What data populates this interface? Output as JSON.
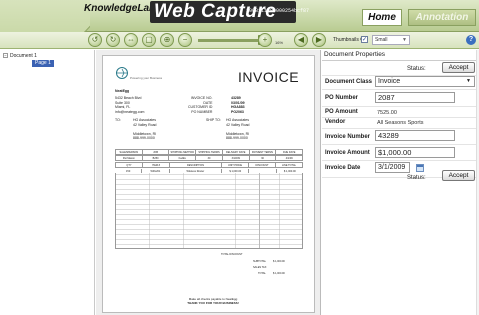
{
  "header": {
    "brand": "KnowledgeLake",
    "product": "Web Capture",
    "doc_id": "2008111200000254bcf87",
    "tabs": {
      "home": "Home",
      "annotation": "Annotation"
    }
  },
  "toolbar": {
    "zoom": "16%",
    "thumbnails_label": "Thumbnails Off",
    "thumbnails_checked": "✓",
    "thumbnail_size": "Small"
  },
  "tree": {
    "document": "Document 1",
    "page": "Page 1"
  },
  "invoice": {
    "title": "INVOICE",
    "tagline": "Powering your Business",
    "company": "NeatEgg",
    "address": [
      "5432 Beach Blvd",
      "Suite 300",
      "Miami, FL",
      "info@neategg.com"
    ],
    "meta_labels": [
      "INVOICE NO.",
      "DATE",
      "CUSTOMER ID",
      "PO NUMBER"
    ],
    "meta_values": [
      "43289",
      "03/01/09",
      "HGA883",
      "PO2063"
    ],
    "to_label": "TO:",
    "to_lines": [
      "HG Associates",
      "42 Valley Road",
      "",
      "Middletown, RI",
      "888-999-0000"
    ],
    "shipto_label": "SHIP TO:",
    "shipto_lines": [
      "HG Associates",
      "42 Valley Road",
      "",
      "Middletown, RI",
      "888-999-0000"
    ],
    "header_row1": [
      "SALESPERSON",
      "JOB",
      "SHIPPING METHOD",
      "SHIPPING TERMS",
      "DELIVERY DATE",
      "PAYMENT TERMS",
      "DUE DATE"
    ],
    "values_row1": [
      "Pat Mason",
      "B250",
      "FedEx",
      "30",
      "3/10/09",
      "30",
      "4/1/09"
    ],
    "header_row2": [
      "QTY",
      "ITEM #",
      "DESCRIPTION",
      "UNIT PRICE",
      "DISCOUNT",
      "LINE TOTAL"
    ],
    "values_row2": [
      "150",
      "WRL201",
      "Wireless Router",
      "$ 1,000.00",
      "",
      "$ 1,000.00"
    ],
    "total_discount": "TOTAL DISCOUNT",
    "subtotal_label": "SUBTOTAL",
    "subtotal": "$ 1,000.00",
    "salestax_label": "SALES TAX",
    "total_label": "TOTAL",
    "total": "$ 1,000.00",
    "footer1": "Make all checks payable to NeatEgg",
    "footer2": "THANK YOU FOR YOUR BUSINESS!"
  },
  "properties": {
    "title": "Document Properties",
    "status_label": "Status:",
    "accept_label": "Accept",
    "fields": {
      "document_class": {
        "label": "Document Class",
        "value": "Invoice"
      },
      "po_number": {
        "label": "PO Number",
        "value": "2087"
      },
      "po_amount": {
        "label": "PO Amount",
        "value": "7525.00"
      },
      "vendor": {
        "label": "Vendor",
        "value": "All Seasons Sports"
      },
      "invoice_number": {
        "label": "Invoice Number",
        "value": "43289"
      },
      "invoice_amount": {
        "label": "Invoice Amount",
        "value": "$1,000.00"
      },
      "invoice_date": {
        "label": "Invoice Date",
        "value": "3/1/2009"
      }
    }
  }
}
